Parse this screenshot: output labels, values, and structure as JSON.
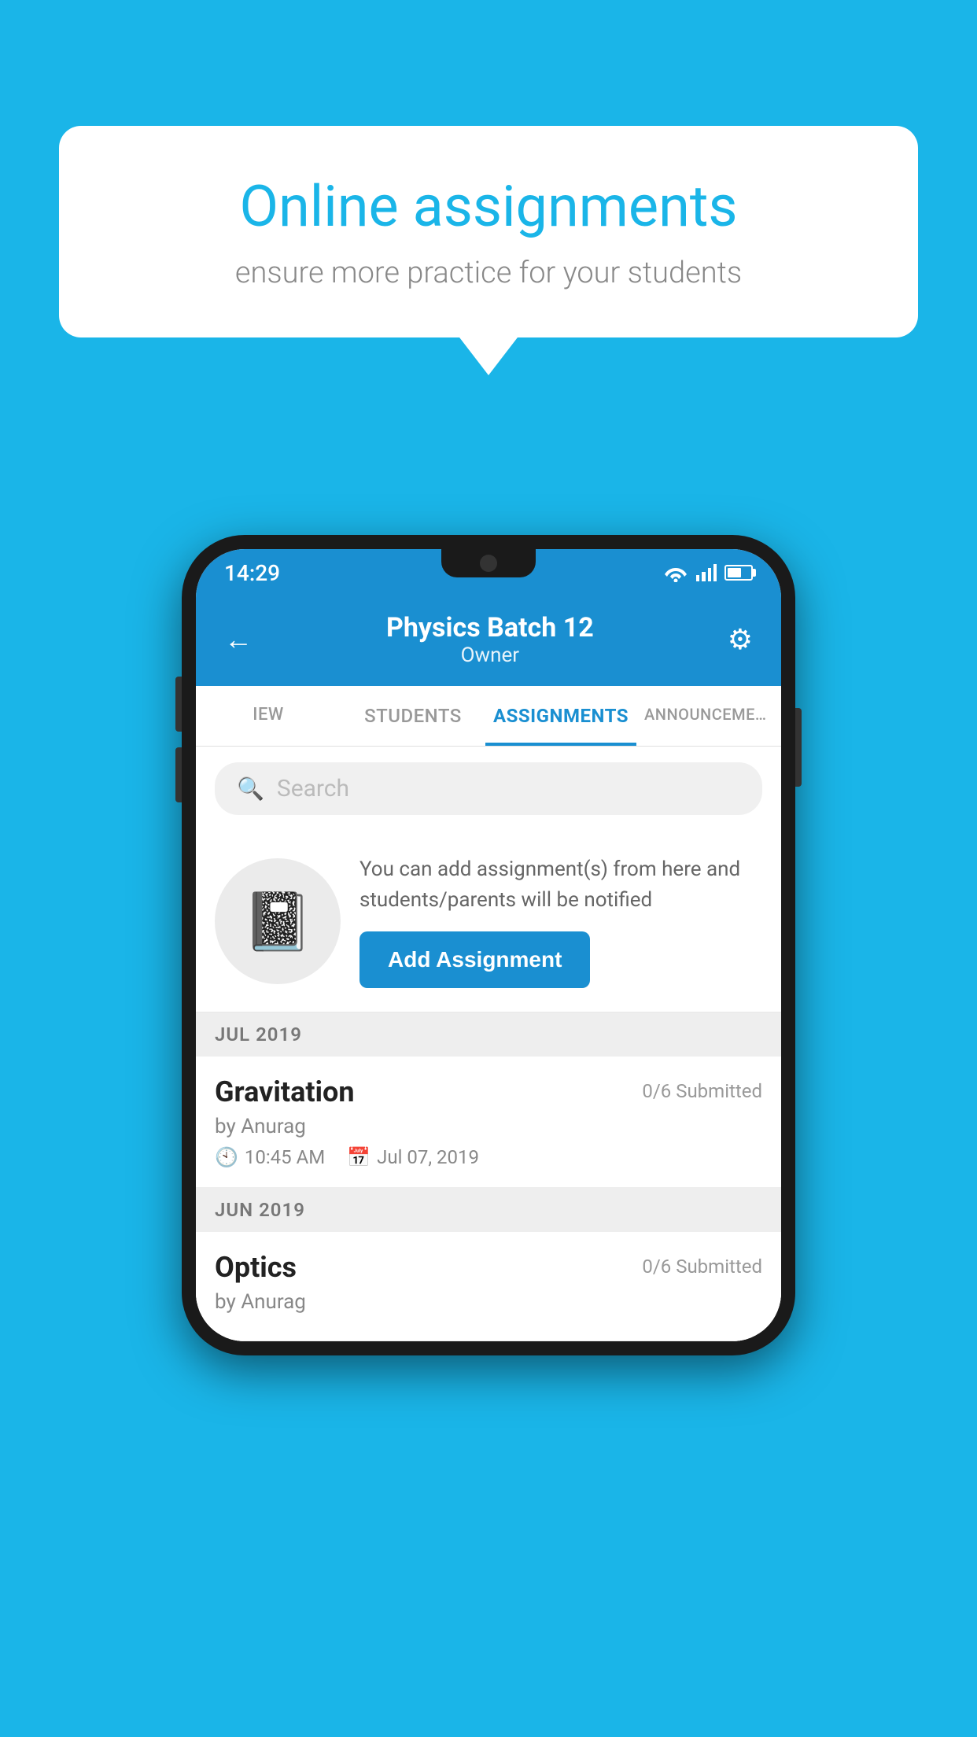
{
  "background_color": "#1ab5e8",
  "speech_bubble": {
    "title": "Online assignments",
    "subtitle": "ensure more practice for your students"
  },
  "phone": {
    "status_bar": {
      "time": "14:29"
    },
    "header": {
      "title": "Physics Batch 12",
      "subtitle": "Owner",
      "back_label": "←",
      "gear_label": "⚙"
    },
    "tabs": [
      {
        "label": "IEW",
        "active": false
      },
      {
        "label": "STUDENTS",
        "active": false
      },
      {
        "label": "ASSIGNMENTS",
        "active": true
      },
      {
        "label": "ANNOUNCEMENTS",
        "active": false
      }
    ],
    "search": {
      "placeholder": "Search"
    },
    "promo": {
      "description": "You can add assignment(s) from here and students/parents will be notified",
      "button_label": "Add Assignment"
    },
    "sections": [
      {
        "month_label": "JUL 2019",
        "assignments": [
          {
            "name": "Gravitation",
            "submitted": "0/6 Submitted",
            "by": "by Anurag",
            "time": "10:45 AM",
            "date": "Jul 07, 2019"
          }
        ]
      },
      {
        "month_label": "JUN 2019",
        "assignments": [
          {
            "name": "Optics",
            "submitted": "0/6 Submitted",
            "by": "by Anurag",
            "time": "",
            "date": ""
          }
        ]
      }
    ]
  }
}
